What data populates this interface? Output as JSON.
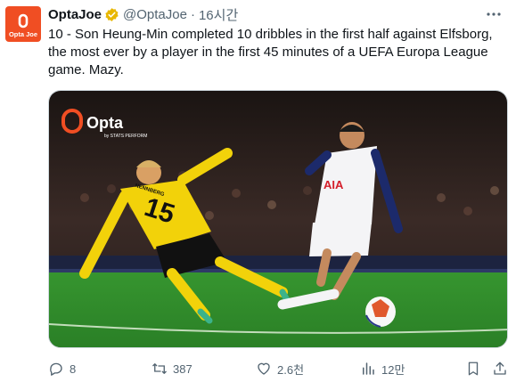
{
  "account": {
    "name": "OptaJoe",
    "handle": "@OptaJoe",
    "separator": "·",
    "time": "16시간",
    "avatar_brand_label": "Opta Joe",
    "verified_color": "#e8b700",
    "avatar_color": "#f04e23"
  },
  "tweet": {
    "line1": "10 - Son Heung-Min completed 10 dribbles in the first half against Elfsborg,",
    "line2": "the most ever by a player in the first 45 minutes of a UEFA Europa League",
    "line3": "game. Mazy."
  },
  "media": {
    "watermark_brand": "Opta",
    "watermark_sub": "by STATS PERFORM",
    "player_number": "15",
    "player_name_print": "NENNBERG",
    "sponsor": "AIA",
    "pitch_color": "#2f8c2a"
  },
  "actions": {
    "replies": "8",
    "reposts": "387",
    "likes": "2.6천",
    "views": "12만"
  }
}
